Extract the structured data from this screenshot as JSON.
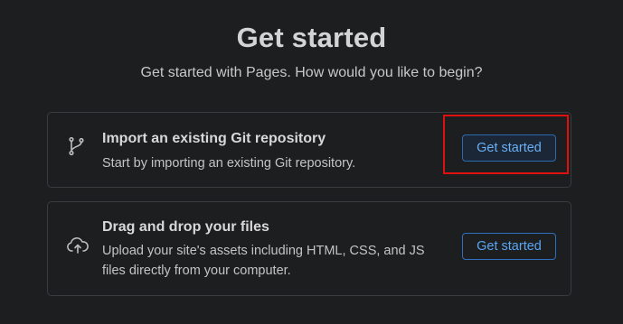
{
  "header": {
    "title": "Get started",
    "subtitle": "Get started with Pages. How would you like to begin?"
  },
  "options": [
    {
      "icon": "git-branch-icon",
      "title": "Import an existing Git repository",
      "description": "Start by importing an existing Git repository.",
      "button_label": "Get started"
    },
    {
      "icon": "cloud-upload-icon",
      "title": "Drag and drop your files",
      "description": "Upload your site's assets including HTML, CSS, and JS files directly from your computer.",
      "button_label": "Get started"
    }
  ],
  "colors": {
    "background": "#1d1e20",
    "card_border": "#3a3b3e",
    "accent": "#5aa6f2",
    "highlight": "#e01010"
  }
}
